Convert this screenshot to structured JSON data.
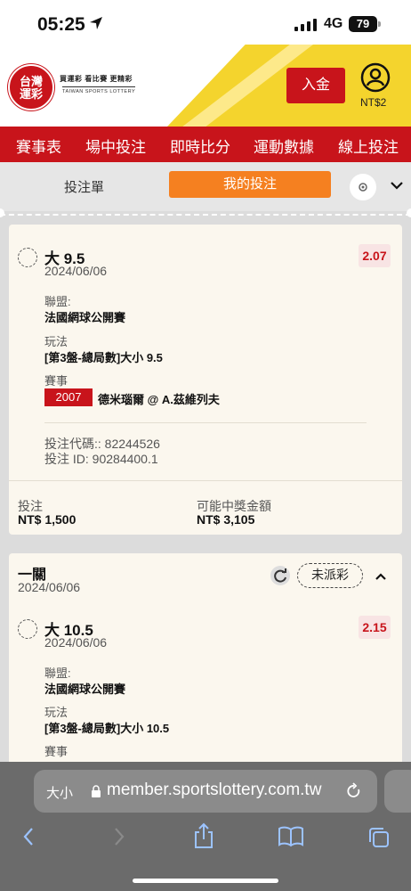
{
  "status_bar": {
    "time": "05:25",
    "network": "4G",
    "battery": "79"
  },
  "header": {
    "logo_line1": "台灣",
    "logo_line2": "運彩",
    "logo_slogan": "買運彩  看比賽  更精彩",
    "logo_english": "TAIWAN SPORTS LOTTERY",
    "deposit_label": "入金",
    "balance": "NT$2"
  },
  "nav": {
    "items": [
      "賽事表",
      "場中投注",
      "即時比分",
      "運動數據",
      "線上投注"
    ]
  },
  "tabs": {
    "bet_slip": "投注單",
    "my_bets": "我的投注"
  },
  "card1": {
    "selection": "大 9.5",
    "date": "2024/06/06",
    "odds": "2.07",
    "league_label": "聯盟:",
    "league": "法國網球公開賽",
    "play_label": "玩法",
    "play": "[第3盤-總局數]大小 9.5",
    "event_label": "賽事",
    "event_code": "2007",
    "event": "德米瑙爾 @ A.茲維列夫",
    "bet_code": "投注代碼:: 82244526",
    "bet_id": "投注 ID: 90284400.1",
    "stake_label": "投注",
    "stake": "NT$ 1,500",
    "payout_label": "可能中獎金額",
    "payout": "NT$ 3,105"
  },
  "card2": {
    "type": "一關",
    "date": "2024/06/06",
    "status": "未派彩",
    "selection": "大 10.5",
    "sel_date": "2024/06/06",
    "odds": "2.15",
    "league_label": "聯盟:",
    "league": "法國網球公開賽",
    "play_label": "玩法",
    "play": "[第3盤-總局數]大小 10.5",
    "event_label": "賽事"
  },
  "browser": {
    "text_size": "大小",
    "url": "member.sportslottery.com.tw"
  },
  "colors": {
    "brand_red": "#c8141b",
    "accent_orange": "#f58020",
    "yellow": "#f4d42d"
  }
}
